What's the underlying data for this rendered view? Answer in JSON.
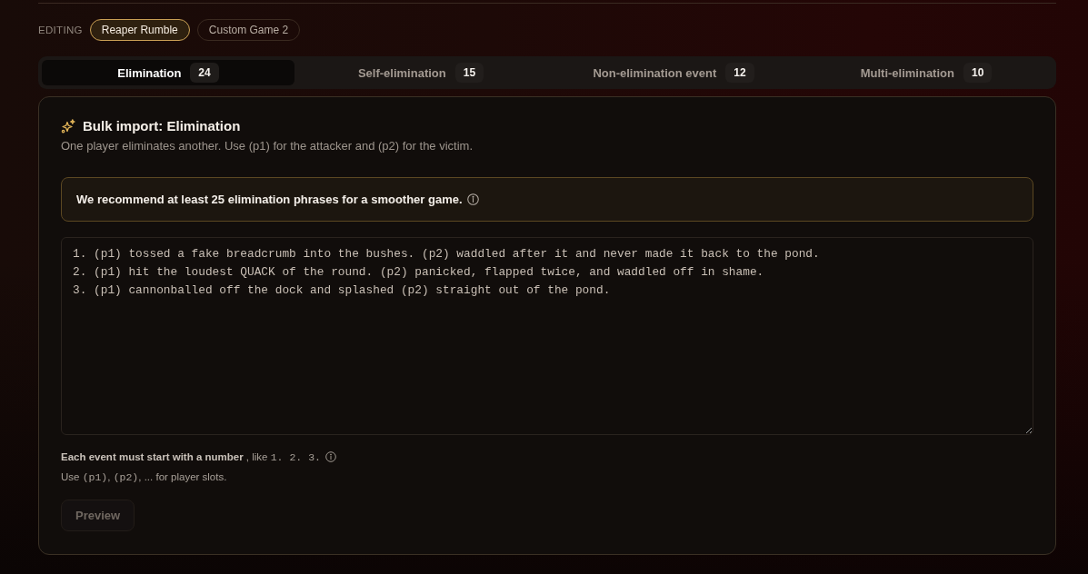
{
  "editing": {
    "label": "EDITING",
    "games": [
      {
        "name": "Reaper Rumble",
        "selected": true
      },
      {
        "name": "Custom Game 2",
        "selected": false
      }
    ]
  },
  "tabs": [
    {
      "label": "Elimination",
      "count": "24",
      "selected": true
    },
    {
      "label": "Self-elimination",
      "count": "15",
      "selected": false
    },
    {
      "label": "Non-elimination event",
      "count": "12",
      "selected": false
    },
    {
      "label": "Multi-elimination",
      "count": "10",
      "selected": false
    }
  ],
  "panel": {
    "title": "Bulk import: Elimination",
    "description": "One player eliminates another. Use (p1) for the attacker and (p2) for the victim.",
    "notice": "We recommend at least 25 elimination phrases for a smoother game.",
    "editor": {
      "lines": [
        "1. (p1) tossed a fake breadcrumb into the bushes. (p2) waddled after it and never made it back to the pond.",
        "2. (p1) hit the loudest QUACK of the round. (p2) panicked, flapped twice, and waddled off in shame.",
        "3. (p1) cannonballed off the dock and splashed (p2) straight out of the pond."
      ]
    },
    "hints": [
      {
        "info_icon": true,
        "segments": [
          {
            "kind": "bold",
            "text": "Each event must start with a number"
          },
          {
            "kind": "plain",
            "text": " , like "
          },
          {
            "kind": "code",
            "text": "1. 2. 3."
          }
        ]
      },
      {
        "info_icon": false,
        "segments": [
          {
            "kind": "plain",
            "text": "Use "
          },
          {
            "kind": "code",
            "text": "(p1)"
          },
          {
            "kind": "plain",
            "text": ", "
          },
          {
            "kind": "code",
            "text": "(p2)"
          },
          {
            "kind": "plain",
            "text": ", ... for player slots."
          }
        ]
      }
    ],
    "preview_button": {
      "label": "Preview",
      "disabled": true
    }
  }
}
